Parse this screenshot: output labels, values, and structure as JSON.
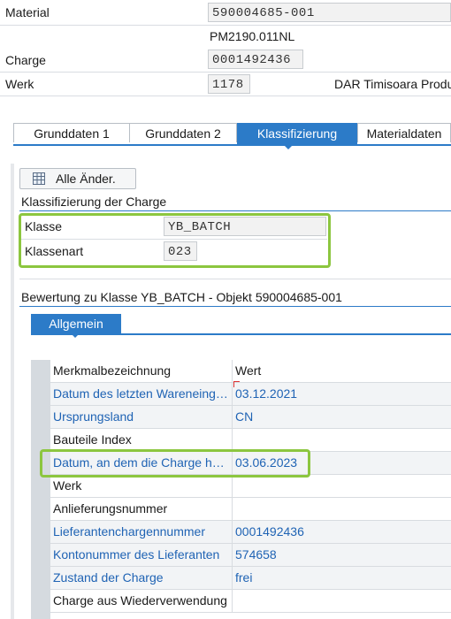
{
  "header": {
    "material_label": "Material",
    "material_value": "590004685-001",
    "material_desc": "PM2190.011NL",
    "charge_label": "Charge",
    "charge_value": "0001492436",
    "werk_label": "Werk",
    "werk_value": "1178",
    "werk_desc": "DAR Timisoara Produ"
  },
  "tabs": [
    {
      "label": "Grunddaten 1",
      "active": false
    },
    {
      "label": "Grunddaten 2",
      "active": false
    },
    {
      "label": "Klassifizierung",
      "active": true
    },
    {
      "label": "Materialdaten",
      "active": false
    }
  ],
  "toolbar": {
    "all_changes_label": "Alle Änder."
  },
  "classification": {
    "title": "Klassifizierung der Charge",
    "klasse_label": "Klasse",
    "klasse_value": "YB_BATCH",
    "klassenart_label": "Klassenart",
    "klassenart_value": "023"
  },
  "evaluation": {
    "title": "Bewertung zu Klasse YB_BATCH - Objekt 590004685-001",
    "subtab": "Allgemein",
    "columns": [
      "Merkmalbezeichnung",
      "Wert"
    ],
    "rows": [
      {
        "name": "Datum des letzten Wareneingangs",
        "value": "03.12.2021",
        "link": true
      },
      {
        "name": "Ursprungsland",
        "value": "CN",
        "link": true
      },
      {
        "name": "Bauteile Index",
        "value": "",
        "link": false
      },
      {
        "name": "Datum, an dem die Charge hergestellt wurde",
        "value": "03.06.2023",
        "link": true
      },
      {
        "name": "Werk",
        "value": "",
        "link": false
      },
      {
        "name": "Anlieferungsnummer",
        "value": "",
        "link": false
      },
      {
        "name": "Lieferantenchargennummer",
        "value": "0001492436",
        "link": true
      },
      {
        "name": "Kontonummer des Lieferanten",
        "value": "574658",
        "link": true
      },
      {
        "name": "Zustand der Charge",
        "value": "frei",
        "link": true
      },
      {
        "name": "Charge aus Wiederverwendung",
        "value": "",
        "link": false
      }
    ]
  },
  "colors": {
    "accent": "#2c7bc8",
    "link": "#1f63b4",
    "highlight": "#8cc63f"
  }
}
